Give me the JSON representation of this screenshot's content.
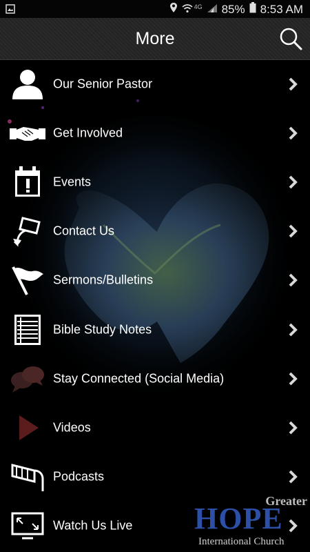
{
  "status_bar": {
    "left_icon": "gallery-icon",
    "network_label": "4G",
    "battery": "85%",
    "time": "8:53 AM"
  },
  "header": {
    "title": "More",
    "search_icon": "search-icon"
  },
  "menu": {
    "items": [
      {
        "label": "Our Senior Pastor",
        "icon": "person-icon"
      },
      {
        "label": "Get Involved",
        "icon": "handshake-icon"
      },
      {
        "label": "Events",
        "icon": "calendar-icon"
      },
      {
        "label": "Contact Us",
        "icon": "sign-arrow-icon"
      },
      {
        "label": "Sermons/Bulletins",
        "icon": "flag-icon"
      },
      {
        "label": "Bible Study Notes",
        "icon": "notes-icon"
      },
      {
        "label": "Stay Connected (Social Media)",
        "icon": "chat-bubbles-icon"
      },
      {
        "label": "Videos",
        "icon": "play-icon"
      },
      {
        "label": "Podcasts",
        "icon": "megaphone-icon"
      },
      {
        "label": "Watch Us Live",
        "icon": "tv-screen-icon"
      }
    ]
  },
  "logo": {
    "top": "Greater",
    "mid": "HOPE",
    "bottom": "International Church"
  },
  "colors": {
    "background": "#000000",
    "header": "#262626",
    "logo_blue": "#2c4fa8",
    "chevron": "#d8d8d8",
    "accent_red": "#6e1a1a"
  }
}
